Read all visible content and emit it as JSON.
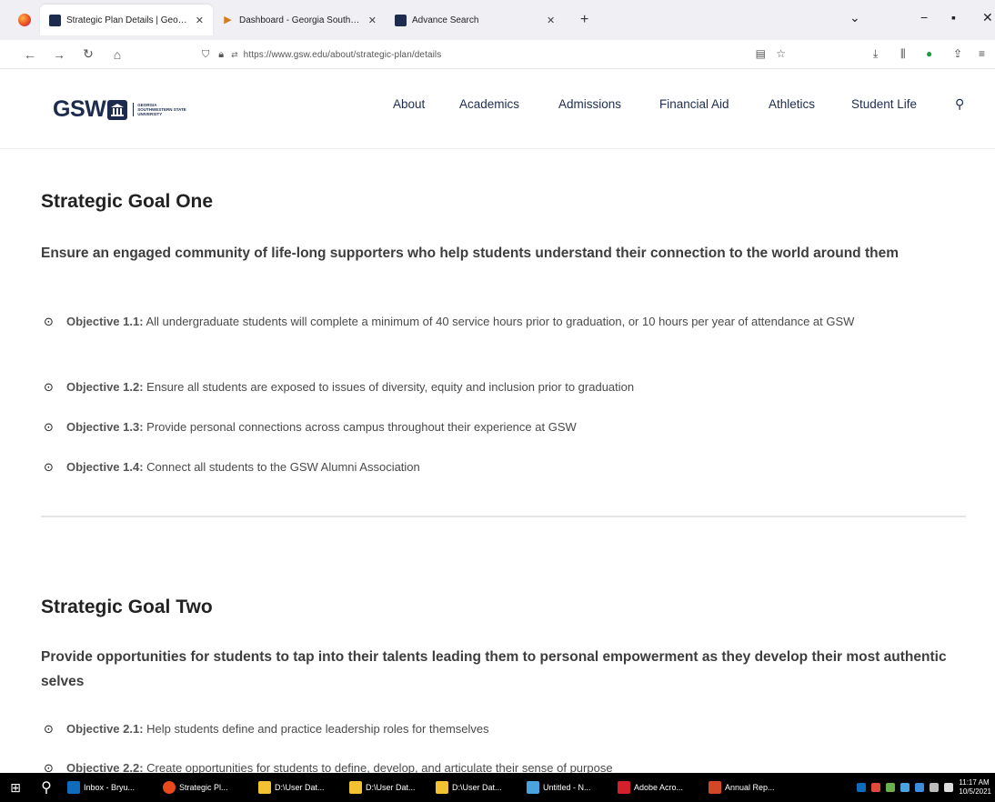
{
  "browser": {
    "tabs": [
      {
        "title": "Strategic Plan Details | Georgia S",
        "active": true
      },
      {
        "title": "Dashboard - Georgia Southwest",
        "active": false
      },
      {
        "title": "Advance Search",
        "active": false
      }
    ],
    "new_tab": "+",
    "url": "https://www.gsw.edu/about/strategic-plan/details"
  },
  "site": {
    "logo_text": "GSW",
    "logo_sub": "GEORGIA SOUTHWESTERN STATE UNIVERSITY",
    "nav": [
      "About",
      "Academics",
      "Admissions",
      "Financial Aid",
      "Athletics",
      "Student Life"
    ],
    "brand_color": "#1d2b4f"
  },
  "goals": [
    {
      "title": "Strategic Goal One",
      "subtitle": "Ensure an engaged community of life-long supporters who help students understand their connection to the world around them",
      "objectives": [
        {
          "label": "Objective 1.1:",
          "text": "All undergraduate students will complete a minimum of 40 service hours prior to graduation, or 10 hours per year of attendance at GSW"
        },
        {
          "label": "Objective 1.2:",
          "text": "Ensure all students are exposed to issues of diversity, equity and inclusion prior to graduation"
        },
        {
          "label": "Objective 1.3:",
          "text": "Provide personal connections across campus throughout their experience at GSW"
        },
        {
          "label": "Objective 1.4:",
          "text": "Connect all students to the GSW Alumni Association"
        }
      ]
    },
    {
      "title": "Strategic Goal Two",
      "subtitle": "Provide opportunities for students to tap into their talents leading them to personal empowerment as they develop their most authentic selves",
      "objectives": [
        {
          "label": "Objective 2.1:",
          "text": "Help students define and practice leadership roles for themselves"
        },
        {
          "label": "Objective 2.2:",
          "text": "Create opportunities for students to define, develop, and articulate their sense of purpose"
        }
      ]
    }
  ],
  "taskbar": {
    "items": [
      {
        "label": "Inbox - Bryu...",
        "color": "#0f6cbd"
      },
      {
        "label": "Strategic Pl...",
        "color": "#e8491d"
      },
      {
        "label": "D:\\User Dat...",
        "color": "#f2c232"
      },
      {
        "label": "D:\\User Dat...",
        "color": "#f2c232"
      },
      {
        "label": "D:\\User Dat...",
        "color": "#f2c232"
      },
      {
        "label": "Untitled - N...",
        "color": "#4aa3df"
      },
      {
        "label": "Adobe Acro...",
        "color": "#d4202b"
      },
      {
        "label": "Annual Rep...",
        "color": "#d24726"
      }
    ],
    "clock_time": "11:17 AM",
    "clock_date": "10/5/2021"
  }
}
